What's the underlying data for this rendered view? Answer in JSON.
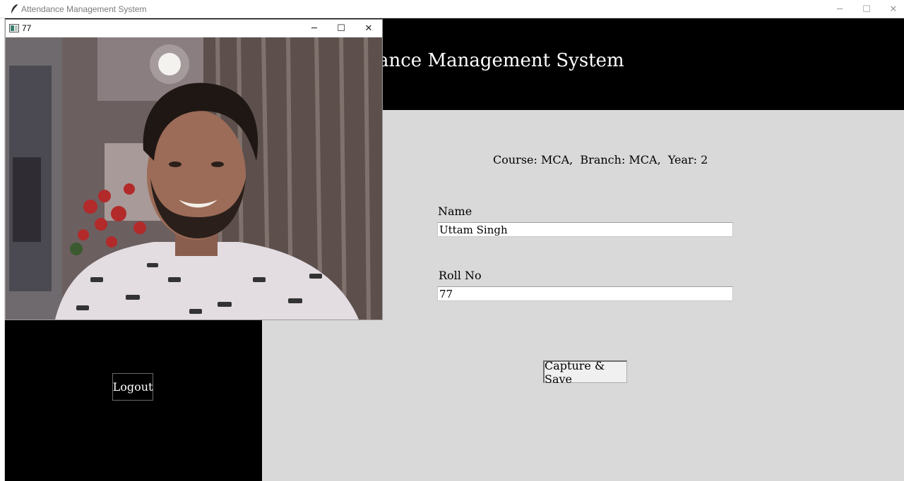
{
  "window": {
    "title": "Attendance Management System",
    "minimize_glyph": "─",
    "maximize_glyph": "☐",
    "close_glyph": "✕"
  },
  "header": {
    "title": "Attendance Management System"
  },
  "info": {
    "text": "Course: MCA,  Branch: MCA,  Year: 2"
  },
  "form": {
    "name_label": "Name",
    "name_value": "Uttam Singh",
    "roll_label": "Roll No",
    "roll_value": "77",
    "capture_button": "Capture & Save"
  },
  "sidebar": {
    "logout_button": "Logout"
  },
  "camera_window": {
    "title": "77",
    "minimize_glyph": "─",
    "maximize_glyph": "☐",
    "close_glyph": "✕"
  },
  "icons": {
    "app_icon": "feather-icon",
    "camera_window_icon": "image-window-icon"
  }
}
